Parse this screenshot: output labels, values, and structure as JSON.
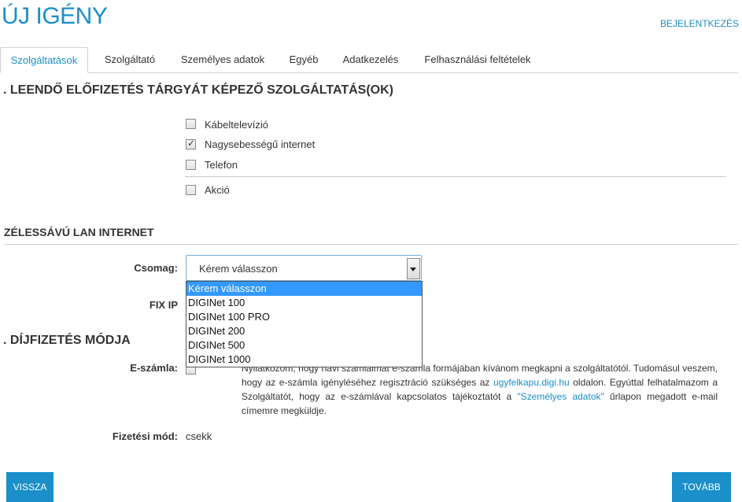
{
  "header": {
    "title": "ÚJ IGÉNY",
    "login_label": "BEJELENTKEZÉS"
  },
  "tabs": [
    {
      "label": "Szolgáltatások",
      "active": true
    },
    {
      "label": "Szolgáltató"
    },
    {
      "label": "Személyes adatok"
    },
    {
      "label": "Egyéb"
    },
    {
      "label": "Adatkezelés"
    },
    {
      "label": "Felhasználási feltételek"
    }
  ],
  "services": {
    "title": ". LEENDŐ ELŐFIZETÉS TÁRGYÁT KÉPEZŐ SZOLGÁLTATÁS(OK)",
    "options": [
      {
        "label": "Kábeltelevízió",
        "checked": false
      },
      {
        "label": "Nagysebességű internet",
        "checked": true
      },
      {
        "label": "Telefon",
        "checked": false
      }
    ],
    "promo": {
      "label": "Akció",
      "checked": false
    }
  },
  "internet": {
    "title": "ZÉLESSÁVÚ LAN INTERNET",
    "package_label": "Csomag:",
    "package_value": "Kérem válasszon",
    "package_options": [
      "Kérem válasszon",
      "DIGINet 100",
      "DIGINet 100 PRO",
      "DIGINet 200",
      "DIGINet 500",
      "DIGINet 1000"
    ],
    "fixip_label": "FIX IP"
  },
  "payment": {
    "title": ". DÍJFIZETÉS MÓDJA",
    "einvoice_label": "E-számla:",
    "einvoice_checked": false,
    "text_1": "Nyilatkozom, hogy havi számláimat e-számla formájában kívánom megkapni a szolgáltatótól. Tudomásul veszem, hogy az e-számla igényléséhez regisztráció szükséges az ",
    "link_1": "ugyfelkapu.digi.hu",
    "text_2": " oldalon. Egyúttal felhatalmazom a Szolgáltatót, hogy az e-számlával kapcsolatos tájékoztatót a ",
    "link_2": "\"Személyes adatok\"",
    "text_3": " űrlapon megadott e-mail címemre megküldje.",
    "method_label": "Fizetési mód:",
    "method_value": "csekk"
  },
  "buttons": {
    "back": "VISSZA",
    "next": "TOVÁBB"
  },
  "colors": {
    "accent": "#1a8fc9",
    "dropdown_highlight": "#3399ff"
  }
}
